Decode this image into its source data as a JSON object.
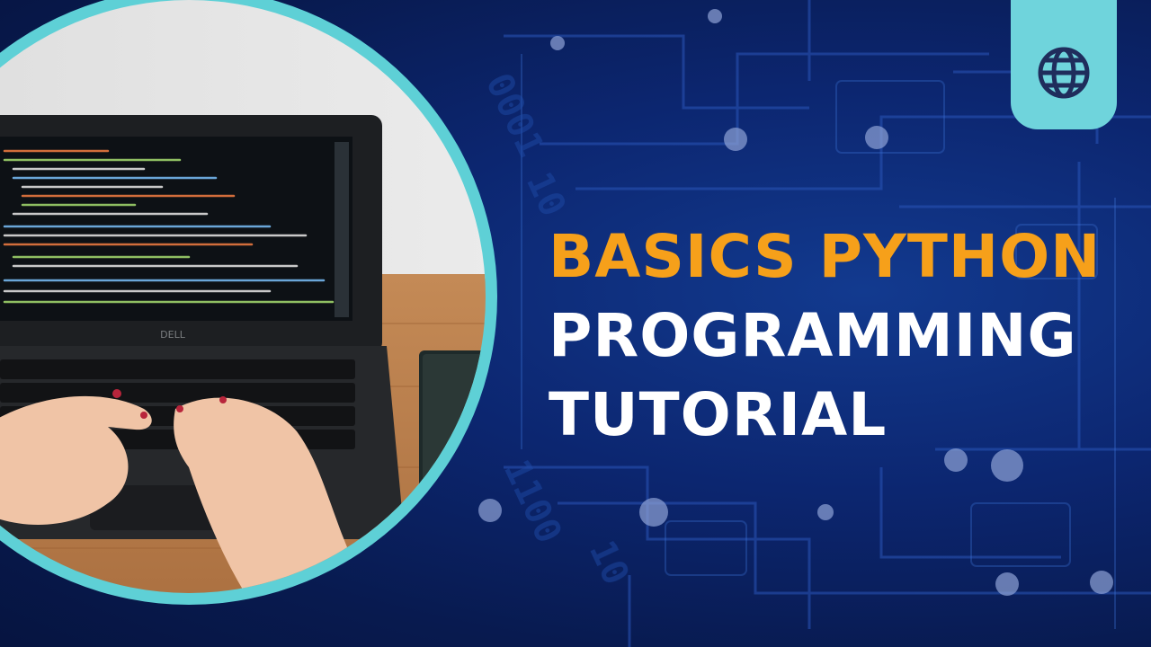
{
  "title": {
    "line1": "BASICS PYTHON",
    "line2": "PROGRAMMING",
    "line3": "TUTORIAL"
  },
  "laptop": {
    "brand": "DELL"
  },
  "icons": {
    "corner": "globe-icon"
  },
  "colors": {
    "background": "#0c2670",
    "title_accent": "#f6a01a",
    "title_main": "#ffffff",
    "ring": "#5ed0d6",
    "tab": "#6fd4dc",
    "icon": "#1f2d5c"
  }
}
